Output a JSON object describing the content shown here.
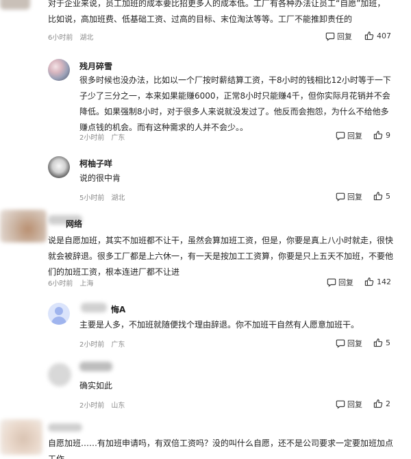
{
  "actions": {
    "reply_label": "回复"
  },
  "comments": [
    {
      "name": "",
      "lines": [
        "对于企业来说，员工加班的成本要比招更多人的成本低。工厂有各种办法让员工“自愿”加班，",
        "比如说，高加班费、低基础工资、过高的目标、末位淘汰等等。工厂不能推卸责任的"
      ],
      "time": "6小时前",
      "location": "湖北",
      "likes": "407"
    },
    {
      "name": "残月碎雪",
      "lines": [
        "很多时候也没办法，比如以一个厂按时薪结算工资，干8小时的钱相比12小时等于一下",
        "子少了三分之一，本来如果能赚6000，正常8小时只能赚4千，但你实际月花销并不会",
        "降低。如果强制8小时，对于很多人来说就没发过了。他反而会抱怨，为什么不给他多",
        "赚点钱的机会。而有这种需求的人并不会少。。"
      ],
      "time": "2小时前",
      "location": "广东",
      "likes": "9"
    },
    {
      "name": "柯柚子咩",
      "lines": [
        "说的很中肯"
      ],
      "time": "5小时前",
      "location": "湖北",
      "likes": "5"
    },
    {
      "name": "网络",
      "lines": [
        "说是自愿加班，其实不加班都不让干，虽然会算加班工资，但是，你要是真上八小时就走，很快",
        "就会被辞退。很多工厂都是上六休一，有一天是按加工工资算，你要是只上五天不加班，不要他",
        "们的加班工资，根本连进厂都不让进"
      ],
      "time": "6小时前",
      "location": "上海",
      "likes": "142"
    },
    {
      "name": "悔A",
      "lines": [
        "主要是人多，不加班就随便找个理由辞退。你不加班干自然有人愿意加班干。"
      ],
      "time": "2小时前",
      "location": "广东",
      "likes": "5"
    },
    {
      "name": "",
      "lines": [
        "确实如此"
      ],
      "time": "2小时前",
      "location": "山东",
      "likes": "2"
    },
    {
      "name": "",
      "lines": [
        "自愿加班……有加班申请吗，有双倍工资吗？没的叫什么自愿，还不是公司要求一定要加班加点",
        "工作"
      ],
      "time": "",
      "location": "",
      "likes": ""
    }
  ],
  "colors": {
    "text": "#222222",
    "meta": "#8a8a8a",
    "background": "#ffffff"
  }
}
